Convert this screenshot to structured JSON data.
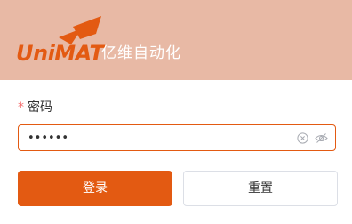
{
  "header": {
    "brand_name": "UniMAT",
    "brand_cn": "亿维自动化"
  },
  "form": {
    "password": {
      "required_mark": "*",
      "label": "密码",
      "value": "123456"
    },
    "login_label": "登录",
    "reset_label": "重置"
  },
  "colors": {
    "accent": "#e35a12",
    "header_bg": "#e8b9a5",
    "required": "#f56c6c",
    "border": "#dcdfe6"
  },
  "icons": {
    "logo_mark": "wing-logo-icon",
    "clear": "clear-icon",
    "visibility": "eye-off-icon"
  }
}
